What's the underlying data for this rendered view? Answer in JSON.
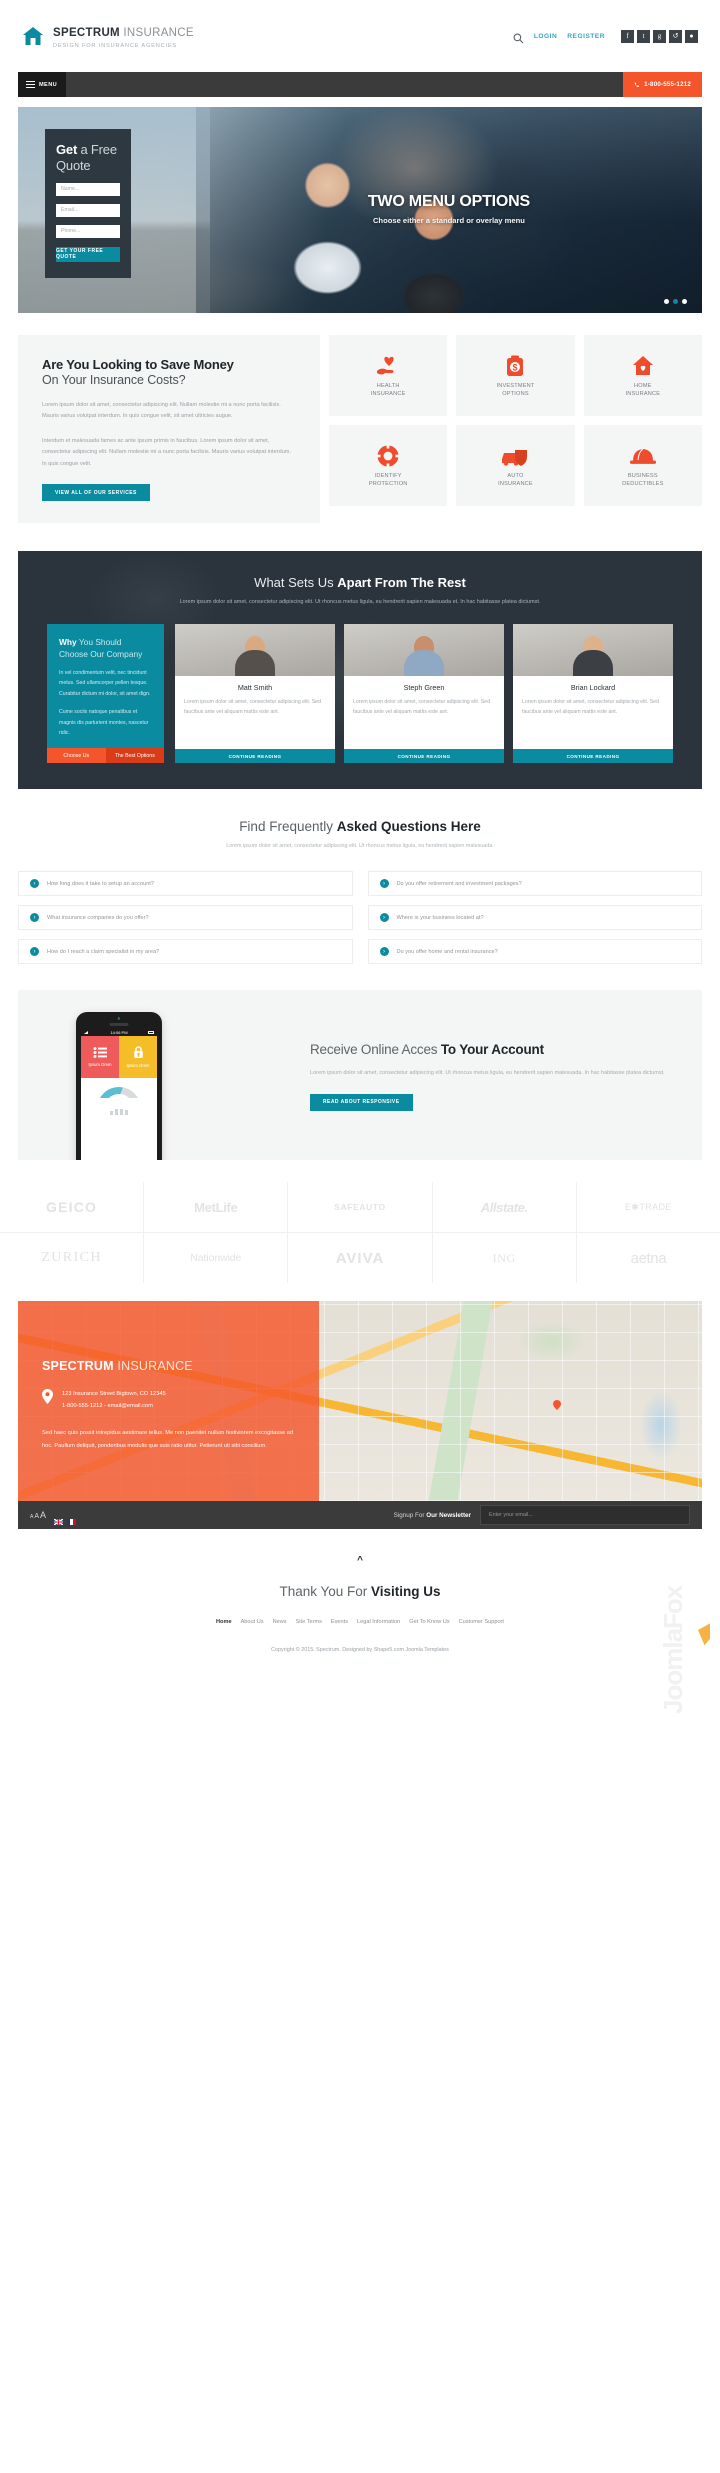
{
  "header": {
    "logo_icon": "house-icon",
    "brand_bold": "SPECTRUM",
    "brand_light": " INSURANCE",
    "tagline": "DESIGN FOR INSURANCE AGENCIES",
    "search_icon": "search-icon",
    "login": "LOGIN",
    "register": "REGISTER",
    "socials": [
      {
        "name": "facebook-icon",
        "glyph": "f"
      },
      {
        "name": "twitter-icon",
        "glyph": "t"
      },
      {
        "name": "google-plus-icon",
        "glyph": "g"
      },
      {
        "name": "rss-icon",
        "glyph": "↺"
      },
      {
        "name": "dribbble-icon",
        "glyph": "●"
      }
    ]
  },
  "nav": {
    "menu_label": "MENU",
    "menu_icon": "hamburger-icon",
    "phone_icon": "phone-icon",
    "phone": "1-800-555-1212",
    "accent": "#f4552b"
  },
  "hero": {
    "form_title_bold": "Get",
    "form_title_light": " a Free Quote",
    "fields": [
      {
        "name": "name-field",
        "placeholder": "Name..."
      },
      {
        "name": "email-field",
        "placeholder": "Email..."
      },
      {
        "name": "phone-field",
        "placeholder": "Phone..."
      }
    ],
    "submit": "GET YOUR FREE QUOTE",
    "title": "TWO MENU OPTIONS",
    "subtitle": "Choose either a standard or overlay menu",
    "slide_count": 3,
    "active_slide": 2,
    "teal": "#0b8ba0"
  },
  "savings": {
    "h1": "Are You Looking to Save Money",
    "h2": "On Your Insurance Costs?",
    "p1": "Lorem ipsum dolor sit amet, consectetur adipiscing elit. Nullam molestie mi a nunc porta facilisis. Mauris varius volutpat interdum. In quis congue velit, sit amet ultricies augue.",
    "p2": "Interdum et malesuada fames ac ante ipsum primis in faucibus. Lorem ipsum dolor sit amet, consectetur adipiscing elit. Nullam molestie mi a nunc porta facilisis. Mauris varius volutpat interdum. In quis congue velit.",
    "button": "VIEW ALL OF OUR SERVICES"
  },
  "service_cards": [
    {
      "icon": "heart-in-hand-icon",
      "line1": "HEALTH",
      "line2": "INSURANCE"
    },
    {
      "icon": "money-can-icon",
      "line1": "INVESTMENT",
      "line2": "OPTIONS"
    },
    {
      "icon": "house-heart-icon",
      "line1": "HOME",
      "line2": "INSURANCE"
    },
    {
      "icon": "life-ring-icon",
      "line1": "IDENTIFY",
      "line2": "PROTECTION"
    },
    {
      "icon": "car-shield-icon",
      "line1": "AUTO",
      "line2": "INSURANCE"
    },
    {
      "icon": "hard-hat-icon",
      "line1": "BUSINESS",
      "line2": "DEDUCTIBLES"
    }
  ],
  "apart": {
    "title_light": "What Sets Us ",
    "title_bold": "Apart From The Rest",
    "subtitle": "Lorem ipsum dolor sit amet, consectetur adipiscing elit. Ut rhoncus metus ligula, eu hendrerit sapien malesuada et. In hac habitasse platea dictumst.",
    "why_bold": "Why",
    "why_light": " You Should Choose Our Company",
    "why_p1": "In vel condimentum velit, nec tincidunt metus. Sed ullamcorper pellen tesque. Curabitur dictum mi dolor, sit amet dign.",
    "why_p2": "Cume sociis natoque penatibus et magnis dis parturient montes, nascetur ridic.",
    "tab1": "Choose Us",
    "tab2": "The Best Options",
    "members": [
      {
        "name": "Matt Smith",
        "text": "Lorem ipsum dolor sit amet, consectetur adipiscing elit. Sed faucibus ante vel aliquam mattis este ant.",
        "button": "CONTINUE READING"
      },
      {
        "name": "Steph Green",
        "text": "Lorem ipsum dolor sit amet, consectetur adipiscing elit. Sed faucibus ante vel aliquam mattis este ant.",
        "button": "CONTINUE READING"
      },
      {
        "name": "Brian Lockard",
        "text": "Lorem ipsum dolor sit amet, consectetur adipiscing elit. Sed faucibus ante vel aliquam mattis este ant.",
        "button": "CONTINUE READING"
      }
    ]
  },
  "faq": {
    "title_light": "Find Frequently ",
    "title_bold": "Asked Questions Here",
    "subtitle": "Lorem ipsum dolor sit amet, consectetur adipiscing elit. Ut rhoncus metus ligula, eu hendrerit sapien malesuada.",
    "items": [
      "How long does it take to setup an account?",
      "Do you offer retirement and investment packages?",
      "What insurance companies do you offer?",
      "Where is your business located at?",
      "How do I reach a claim specialist in my area?",
      "Do you offer home and rental insurance?"
    ],
    "chevron_icon": "chevron-right-icon"
  },
  "responsive": {
    "title_light": "Receive Online Acces ",
    "title_bold": "To Your Account",
    "p": "Lorem ipsum dolor sit amet, consectetur adipiscing elit. Ut rhoncus metus ligula, eu hendrerit sapien malesuada. In hac habitasse platea dictumst.",
    "button": "READ ABOUT RESPONSIVE",
    "phone_time": "14:06 PM",
    "tile1_label": "Ipsum Orem",
    "tile1_icon": "list-icon",
    "tile2_label": "Ipsum Orem",
    "tile2_icon": "lock-icon",
    "tile1_color": "#ef5b5b",
    "tile2_color": "#f5bd27"
  },
  "brand_logos": [
    [
      "GEICO",
      "MetLife",
      "SAFEAUTO",
      "Allstate.",
      "E✱TRADE"
    ],
    [
      "ZURICH",
      "Nationwide",
      "AVIVA",
      "ING",
      "aetna"
    ]
  ],
  "contact": {
    "title_bold": "SPECTRUM",
    "title_light": " INSURANCE",
    "pin_icon": "map-pin-icon",
    "address": "123 Insurance Street Bigtown, CO 12345",
    "contact_line": "1-800-555-1212 - email@email.com",
    "body": "Sed haec quis possit intrepidus aestimare tellus. Me non paenitet nullum festiviorem excogitasse ad hoc. Paullum deliquit, ponderibus modulis que suis ratio utitur. Petierunt uti sibi concilium."
  },
  "newsletter": {
    "font_sizes": [
      "A",
      "A",
      "A"
    ],
    "flags": [
      "uk-flag-icon",
      "france-flag-icon"
    ],
    "label_light": "Signup For ",
    "label_bold": "Our Newsletter",
    "placeholder": "Enter your email..."
  },
  "footer": {
    "scroll_top_icon": "chevron-up-icon",
    "thanks_light": "Thank You For ",
    "thanks_bold": "Visiting Us",
    "links": [
      "Home",
      "About Us",
      "News",
      "Site Terms",
      "Events",
      "Legal Information",
      "Get To Know Us",
      "Customer Support"
    ],
    "copyright": "Copyright © 2015. Spectrum. Designed by Shape5.com Joomla Templates",
    "watermark": "JoomlaFox"
  }
}
